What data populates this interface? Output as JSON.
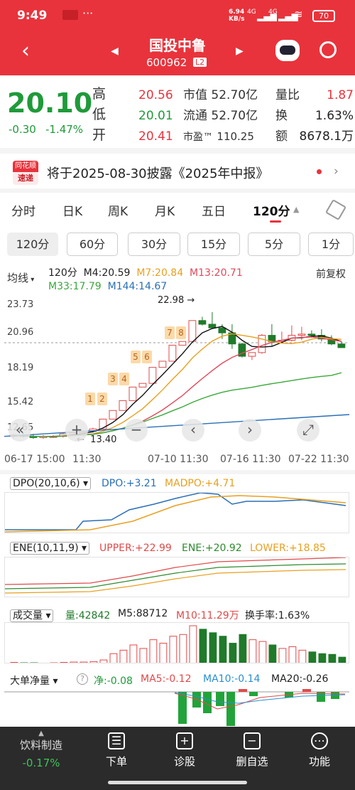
{
  "status": {
    "time": "9:49",
    "net_speed_val": "6.94",
    "net_speed_unit": "KB/s",
    "signal": "4G",
    "signal2": "4G",
    "battery": "70"
  },
  "nav": {
    "stock_name": "国投中鲁",
    "stock_code": "600962",
    "level": "L2"
  },
  "quote": {
    "price": "20.10",
    "change": "-0.30",
    "change_pct": "-1.47%",
    "high_label": "高",
    "high": "20.56",
    "low_label": "低",
    "low": "20.01",
    "open_label": "开",
    "open": "20.41",
    "mcap_label": "市值",
    "mcap": "52.70亿",
    "float_label": "流通",
    "float": "52.70亿",
    "pe_label": "市盈™",
    "pe": "110.25",
    "vr_label": "量比",
    "vr": "1.87",
    "turn_label": "换",
    "turn": "1.63%",
    "amt_label": "额",
    "amt": "8678.1万"
  },
  "notice": {
    "brand_top": "同花顺",
    "brand_bottom": "速递",
    "text": "将于2025-08-30披露《2025年中报》"
  },
  "tabs": [
    "分时",
    "日K",
    "周K",
    "月K",
    "五日",
    "120分"
  ],
  "periods": [
    "120分",
    "60分",
    "30分",
    "15分",
    "5分",
    "1分"
  ],
  "ma": {
    "label": "均线",
    "period": "120分",
    "m4": "M4:20.59",
    "m7": "M7:20.84",
    "m13": "M13:20.71",
    "m33": "M33:17.79",
    "m144": "M144:14.67",
    "adjust": "前复权"
  },
  "y_ticks": [
    "23.73",
    "20.96",
    "18.19",
    "15.42",
    "12.65"
  ],
  "x_ticks": [
    "06-17 15:00",
    "11:30",
    "07-10 11:30",
    "07-16 11:30",
    "07-22 11:30"
  ],
  "annot": {
    "max": "22.98",
    "min": "13.40"
  },
  "markers": [
    "1",
    "2",
    "3",
    "4",
    "5",
    "6",
    "7",
    "8"
  ],
  "dpo": {
    "name": "DPO(20,10,6)",
    "v": "DPO:+3.21",
    "ma": "MADPO:+4.71"
  },
  "ene": {
    "name": "ENE(10,11,9)",
    "upper": "UPPER:+22.99",
    "mid": "ENE:+20.92",
    "lower": "LOWER:+18.85"
  },
  "vol": {
    "name": "成交量",
    "v": "量:42842",
    "m5": "M5:88712",
    "m10": "M10:11.29万",
    "turn": "换手率:1.63%"
  },
  "big": {
    "name": "大单净量",
    "v": "净:-0.08",
    "ma5": "MA5:-0.12",
    "ma10": "MA10:-0.14",
    "ma20": "MA20:-0.26"
  },
  "bottom": {
    "sector": "饮料制造",
    "sector_pct": "-0.17%",
    "b1": "下单",
    "b2": "诊股",
    "b3": "删自选",
    "b4": "功能"
  },
  "chart_data": {
    "type": "candlestick",
    "ylim": [
      12.65,
      23.73
    ],
    "max": 22.98,
    "min": 13.4,
    "ohlc": [
      [
        12.9,
        13.1,
        12.7,
        13.0
      ],
      [
        13.0,
        13.2,
        12.8,
        12.9
      ],
      [
        12.9,
        13.1,
        12.7,
        12.8
      ],
      [
        12.8,
        13.0,
        12.7,
        12.9
      ],
      [
        12.9,
        13.0,
        12.8,
        12.9
      ],
      [
        12.9,
        13.2,
        12.8,
        13.1
      ],
      [
        13.1,
        13.3,
        13.0,
        13.2
      ],
      [
        13.2,
        13.4,
        13.1,
        13.3
      ],
      [
        13.3,
        13.6,
        13.2,
        13.5
      ],
      [
        13.5,
        14.3,
        13.5,
        14.3
      ],
      [
        14.3,
        15.0,
        14.3,
        15.0
      ],
      [
        15.0,
        15.8,
        15.0,
        15.8
      ],
      [
        15.8,
        16.9,
        15.8,
        16.9
      ],
      [
        16.9,
        17.2,
        16.9,
        17.2
      ],
      [
        17.2,
        18.5,
        17.2,
        18.5
      ],
      [
        18.5,
        19.0,
        18.5,
        19.0
      ],
      [
        19.0,
        20.3,
        19.0,
        20.3
      ],
      [
        20.3,
        20.6,
        20.3,
        20.6
      ],
      [
        20.6,
        22.3,
        20.6,
        22.3
      ],
      [
        22.3,
        22.6,
        21.9,
        22.0
      ],
      [
        22.0,
        22.98,
        21.7,
        21.7
      ],
      [
        21.7,
        22.0,
        20.8,
        21.3
      ],
      [
        21.3,
        22.0,
        20.0,
        20.4
      ],
      [
        20.4,
        20.5,
        19.3,
        19.4
      ],
      [
        19.4,
        19.7,
        19.1,
        19.7
      ],
      [
        19.7,
        21.2,
        19.6,
        21.1
      ],
      [
        21.1,
        22.0,
        20.2,
        20.6
      ],
      [
        20.6,
        21.4,
        20.5,
        20.7
      ],
      [
        20.7,
        21.9,
        20.6,
        21.1
      ],
      [
        21.1,
        21.8,
        20.7,
        21.2
      ],
      [
        21.2,
        21.5,
        20.9,
        21.1
      ],
      [
        21.1,
        21.6,
        20.6,
        20.8
      ],
      [
        20.8,
        21.1,
        20.3,
        20.4
      ],
      [
        20.4,
        20.6,
        20.1,
        20.1
      ]
    ],
    "volume": [
      5,
      4,
      4,
      3,
      4,
      5,
      6,
      6,
      7,
      12,
      30,
      40,
      55,
      45,
      70,
      60,
      80,
      85,
      110,
      100,
      90,
      80,
      60,
      85,
      70,
      65,
      55,
      45,
      50,
      40,
      35,
      30,
      28,
      20
    ]
  }
}
